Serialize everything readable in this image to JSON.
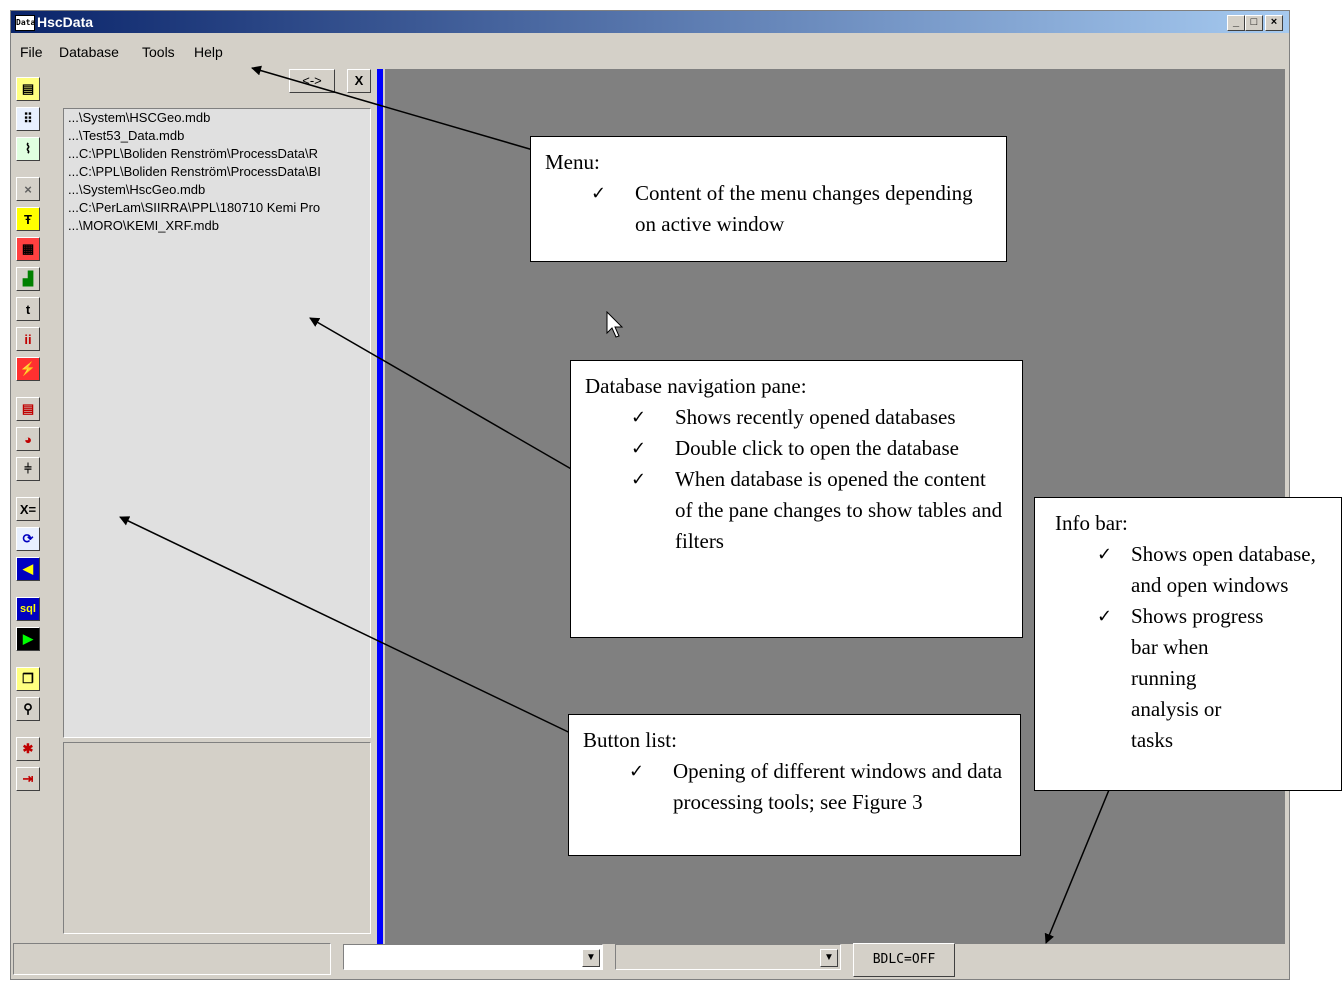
{
  "window": {
    "title": "HscData",
    "icon_label": "Data",
    "controls": {
      "minimize": "_",
      "maximize": "□",
      "close": "×"
    }
  },
  "menu": {
    "items": [
      "File",
      "Database",
      "Tools",
      "Help"
    ]
  },
  "nav_pane": {
    "swap_button": "<->",
    "close_button": "X",
    "items": [
      "...\\System\\HSCGeo.mdb",
      "...\\Test53_Data.mdb",
      "...C:\\PPL\\Boliden Renström\\ProcessData\\R",
      "...C:\\PPL\\Boliden Renström\\ProcessData\\BI",
      "...\\System\\HscGeo.mdb",
      "...C:\\PerLam\\SIIRRA\\PPL\\180710 Kemi Pro",
      "...\\MORO\\KEMI_XRF.mdb"
    ]
  },
  "toolbar_icons": [
    "filter-icon",
    "scatter-icon",
    "map-icon",
    "delete-icon",
    "stats-icon",
    "grid-icon",
    "histogram-icon",
    "text-icon",
    "people-icon",
    "flash-icon",
    "table-icon",
    "pie-icon",
    "split-icon",
    "formula-icon",
    "refresh-icon",
    "back-icon",
    "sql-icon",
    "run-icon",
    "windows-icon",
    "tool-icon",
    "target-icon",
    "exit-icon"
  ],
  "status": {
    "bdlc": "BDLC=OFF"
  },
  "callouts": {
    "menu": {
      "title": "Menu:",
      "bullets": [
        "Content of the menu changes depending on active window"
      ]
    },
    "nav": {
      "title": "Database navigation pane:",
      "bullets": [
        "Shows recently opened databases",
        "Double click to open the database",
        "When database is opened the content of the pane changes to show tables and filters"
      ]
    },
    "buttons": {
      "title": "Button list:",
      "bullets": [
        "Opening of different windows and data processing tools; see Figure 3"
      ]
    },
    "info": {
      "title": "Info bar:",
      "bullets": [
        "Shows open database, and open windows",
        "Shows progress bar when running analysis or tasks"
      ]
    }
  }
}
